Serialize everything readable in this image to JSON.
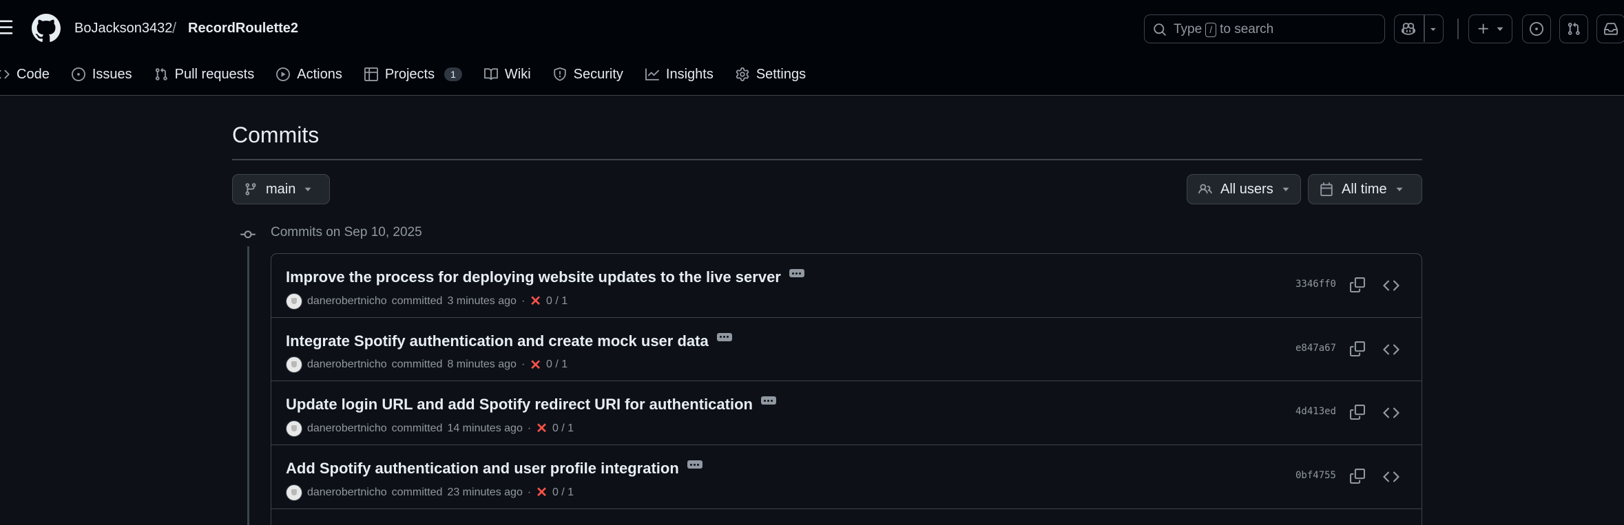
{
  "header": {
    "owner": "BoJackson3432",
    "separator": "/",
    "repo": "RecordRoulette2",
    "search": {
      "prefix": "Type",
      "key": "/",
      "suffix": "to search"
    }
  },
  "nav": {
    "tabs": [
      {
        "label": "Code",
        "icon": "code-icon"
      },
      {
        "label": "Issues",
        "icon": "issue-opened-icon"
      },
      {
        "label": "Pull requests",
        "icon": "git-pull-request-icon"
      },
      {
        "label": "Actions",
        "icon": "play-icon"
      },
      {
        "label": "Projects",
        "icon": "table-icon",
        "counter": "1"
      },
      {
        "label": "Wiki",
        "icon": "book-icon"
      },
      {
        "label": "Security",
        "icon": "shield-icon"
      },
      {
        "label": "Insights",
        "icon": "graph-icon"
      },
      {
        "label": "Settings",
        "icon": "gear-icon"
      }
    ]
  },
  "page": {
    "title": "Commits",
    "branch": "main",
    "users_filter": "All users",
    "time_filter": "All time",
    "group_label": "Commits on Sep 10, 2025"
  },
  "commits": [
    {
      "message": "Improve the process for deploying website updates to the live server",
      "author": "danerobertnicho",
      "action": "committed",
      "time": "3 minutes ago",
      "status": "0 / 1",
      "sha": "3346ff0"
    },
    {
      "message": "Integrate Spotify authentication and create mock user data",
      "author": "danerobertnicho",
      "action": "committed",
      "time": "8 minutes ago",
      "status": "0 / 1",
      "sha": "e847a67"
    },
    {
      "message": "Update login URL and add Spotify redirect URI for authentication",
      "author": "danerobertnicho",
      "action": "committed",
      "time": "14 minutes ago",
      "status": "0 / 1",
      "sha": "4d413ed"
    },
    {
      "message": "Add Spotify authentication and user profile integration",
      "author": "danerobertnicho",
      "action": "committed",
      "time": "23 minutes ago",
      "status": "0 / 1",
      "sha": "0bf4755"
    }
  ],
  "colors": {
    "background": "#0d1117",
    "header_background": "#010409",
    "border": "#3d444d",
    "fail": "#f85149",
    "muted_text": "#9198a1"
  }
}
